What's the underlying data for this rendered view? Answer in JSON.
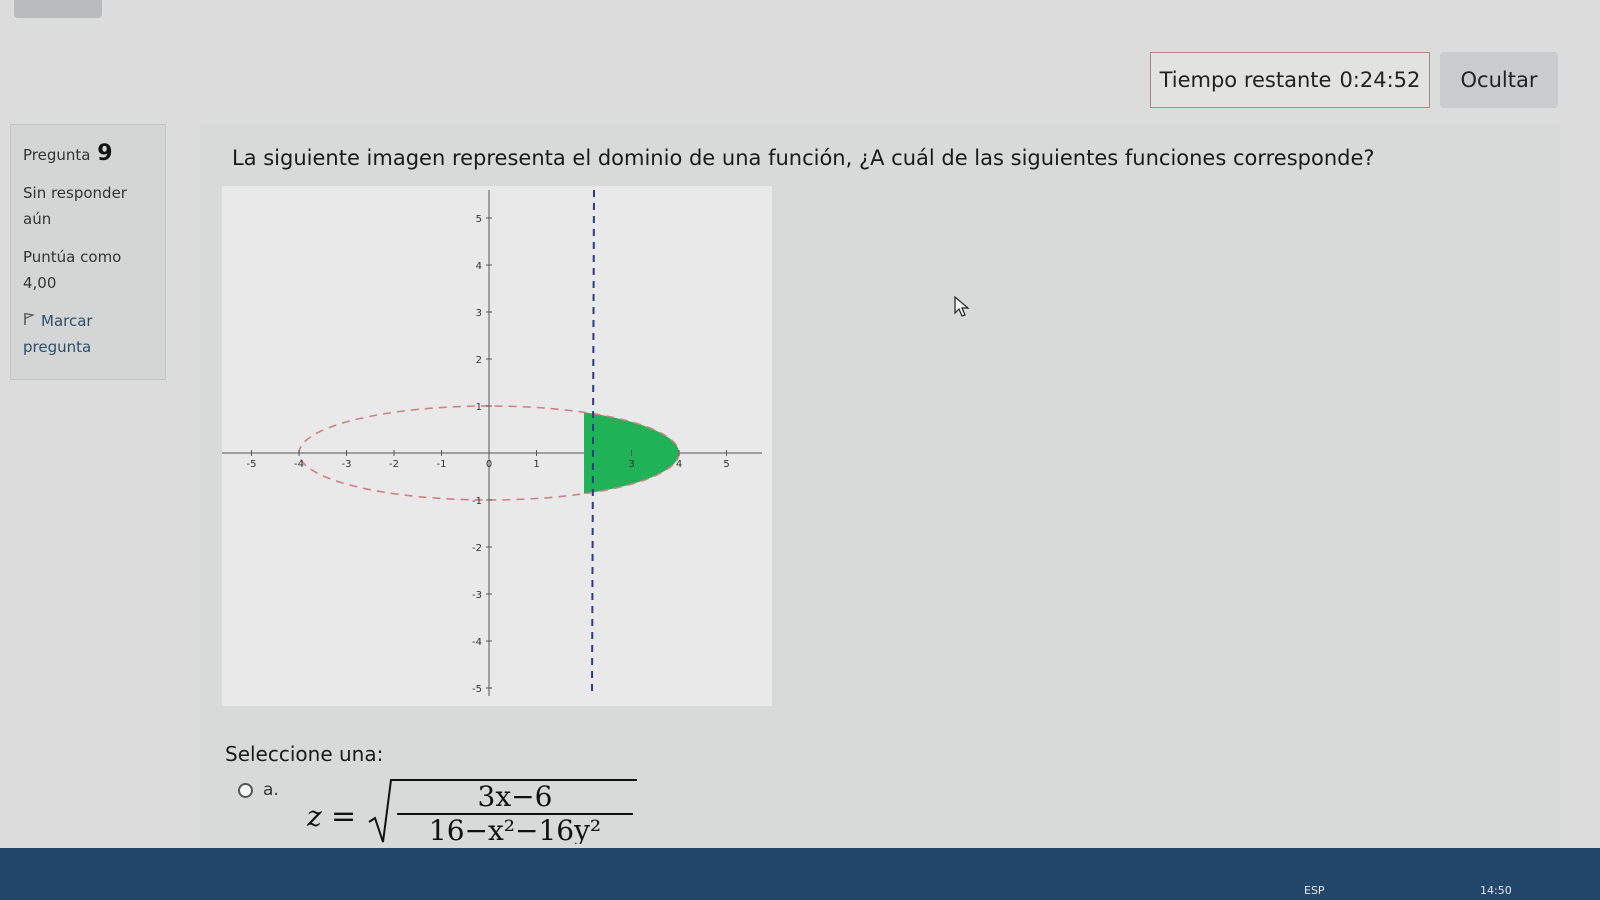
{
  "header": {
    "timer_label": "Tiempo restante",
    "timer_value": "0:24:52",
    "hide_button": "Ocultar"
  },
  "info": {
    "question_label": "Pregunta",
    "question_number": "9",
    "state": "Sin responder aún",
    "grade_label": "Puntúa como",
    "grade_value": "4,00",
    "flag_label": "Marcar pregunta"
  },
  "question": {
    "text": "La siguiente imagen representa el dominio de una función, ¿A cuál de las siguientes funciones corresponde?"
  },
  "graph": {
    "x_ticks": [
      "-5",
      "-4",
      "-3",
      "-2",
      "-1",
      "0",
      "1",
      "3",
      "4",
      "5"
    ],
    "y_ticks": [
      "5",
      "4",
      "3",
      "2",
      "1",
      "-1",
      "-2",
      "-3",
      "-4",
      "-5"
    ],
    "ellipse_semi_axes": [
      4,
      1
    ],
    "dashed_vertical_line_x": 2,
    "shaded_region": "ellipse interior with x >= 2",
    "shade_color": "#1fb257",
    "boundary_color": "#d08080"
  },
  "answers": {
    "prompt": "Seleccione una:",
    "options": [
      {
        "letter": "a.",
        "lhs": "z",
        "numerator": "3x−6",
        "denominator": "16−x²−16y²"
      }
    ]
  },
  "taskbar": {
    "text_a": "ESP",
    "text_b": "14:50"
  }
}
